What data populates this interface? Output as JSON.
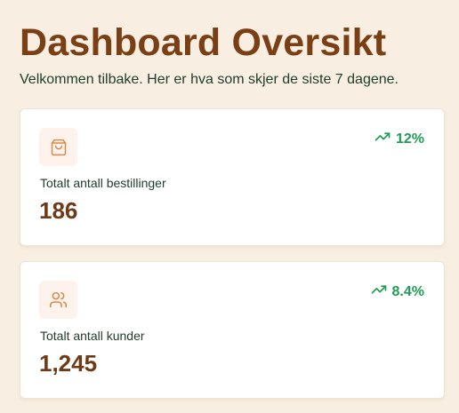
{
  "header": {
    "title": "Dashboard Oversikt",
    "subtitle": "Velkommen tilbake. Her er hva som skjer de siste 7 dagene."
  },
  "cards": [
    {
      "icon": "shopping-bag-icon",
      "trend": "12%",
      "label": "Totalt antall bestillinger",
      "value": "186"
    },
    {
      "icon": "users-icon",
      "trend": "8.4%",
      "label": "Totalt antall kunder",
      "value": "1,245"
    }
  ],
  "colors": {
    "background": "#f8efe2",
    "title": "#7a3f14",
    "accent_icon": "#d98a4b",
    "trend_positive": "#1f9d55"
  }
}
